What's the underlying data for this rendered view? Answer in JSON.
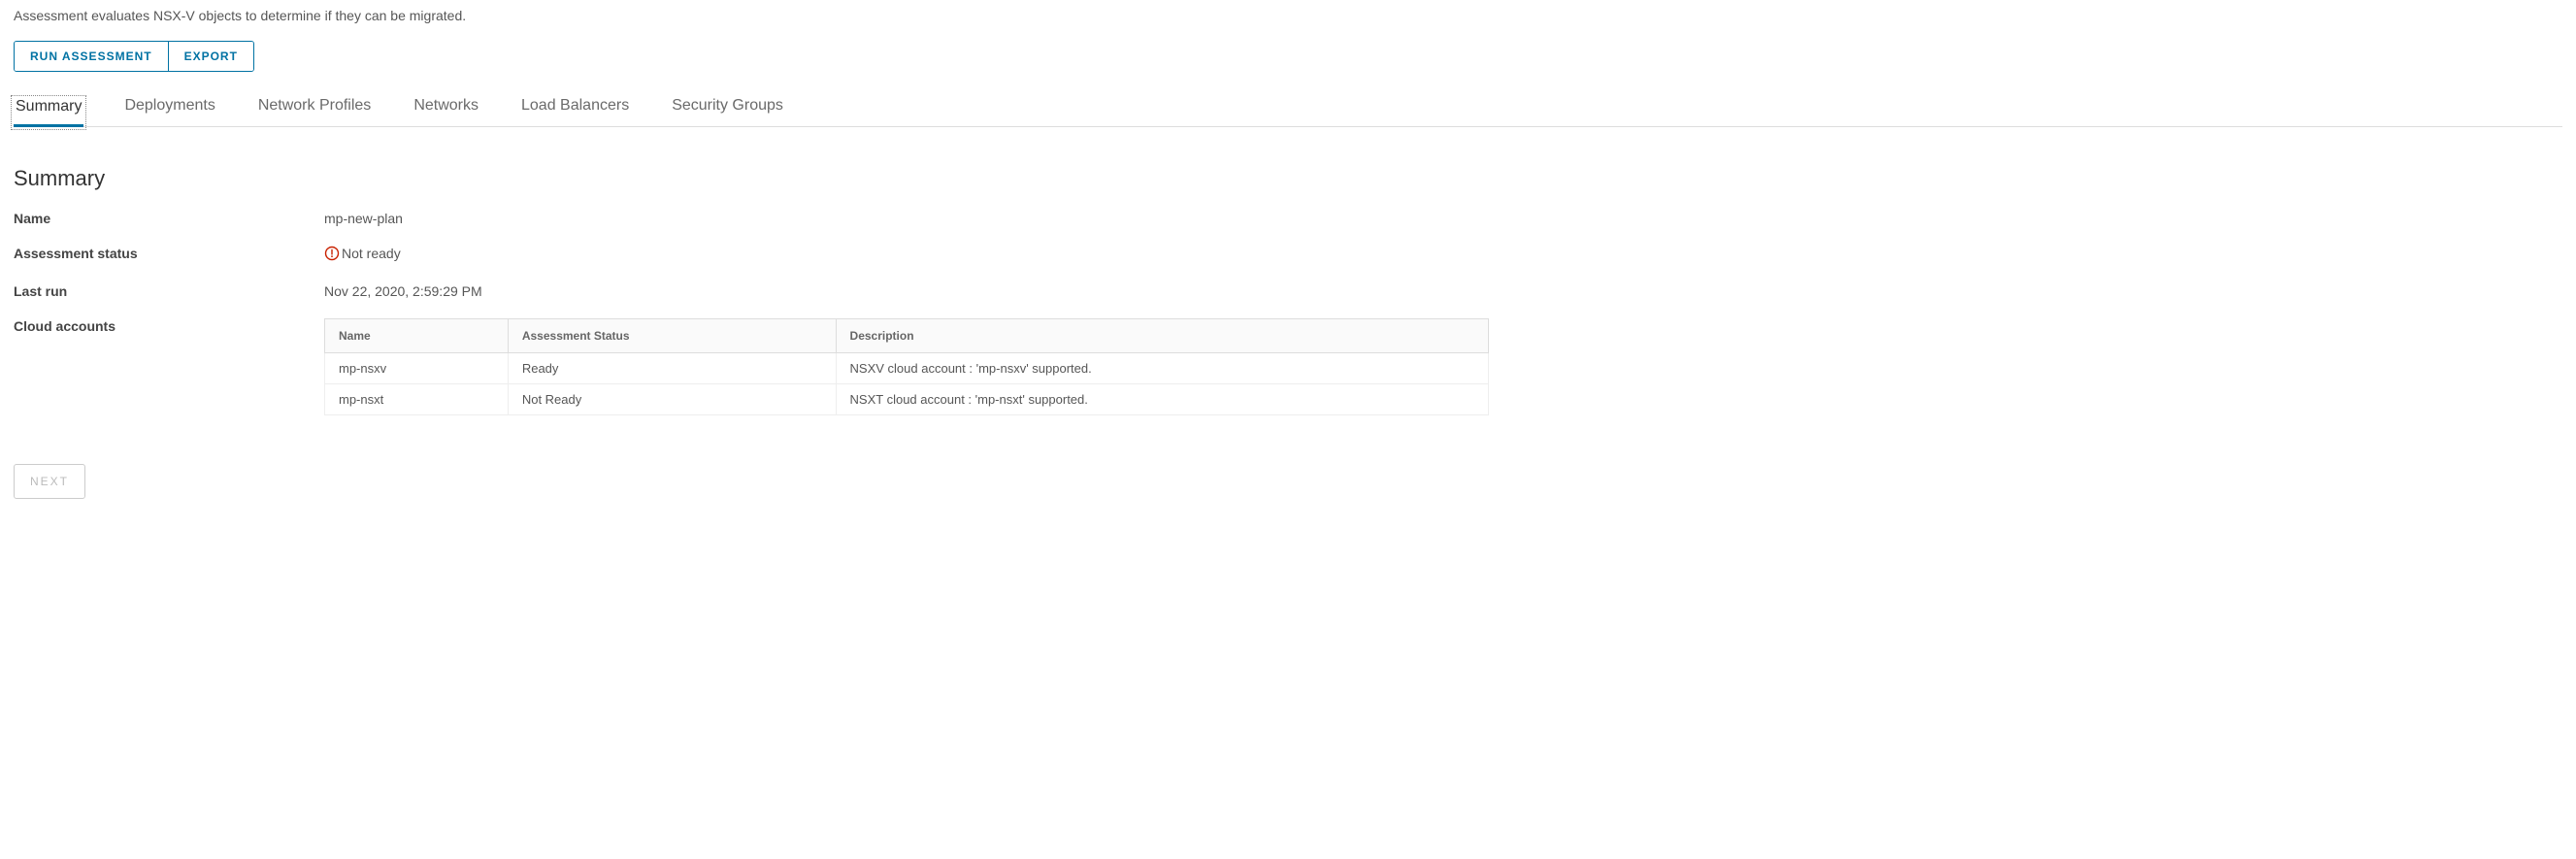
{
  "description": "Assessment evaluates NSX-V objects to determine if they can be migrated.",
  "actions": {
    "run_assessment": "RUN ASSESSMENT",
    "export": "EXPORT",
    "next": "NEXT"
  },
  "tabs": [
    {
      "id": "summary",
      "label": "Summary",
      "active": true
    },
    {
      "id": "deployments",
      "label": "Deployments",
      "active": false
    },
    {
      "id": "network-profiles",
      "label": "Network Profiles",
      "active": false
    },
    {
      "id": "networks",
      "label": "Networks",
      "active": false
    },
    {
      "id": "load-balancers",
      "label": "Load Balancers",
      "active": false
    },
    {
      "id": "security-groups",
      "label": "Security Groups",
      "active": false
    }
  ],
  "section_title": "Summary",
  "summary_labels": {
    "name": "Name",
    "assessment_status": "Assessment status",
    "last_run": "Last run",
    "cloud_accounts": "Cloud accounts"
  },
  "summary_values": {
    "name": "mp-new-plan",
    "assessment_status": "Not ready",
    "assessment_status_severity": "error",
    "last_run": "Nov 22, 2020, 2:59:29 PM"
  },
  "cloud_accounts_table": {
    "headers": {
      "name": "Name",
      "assessment_status": "Assessment Status",
      "description": "Description"
    },
    "rows": [
      {
        "name": "mp-nsxv",
        "status": "Ready",
        "description": "NSXV cloud account : 'mp-nsxv' supported."
      },
      {
        "name": "mp-nsxt",
        "status": "Not Ready",
        "description": "NSXT cloud account : 'mp-nsxt' supported."
      }
    ]
  },
  "colors": {
    "primary": "#0072a3",
    "error": "#c92100"
  }
}
